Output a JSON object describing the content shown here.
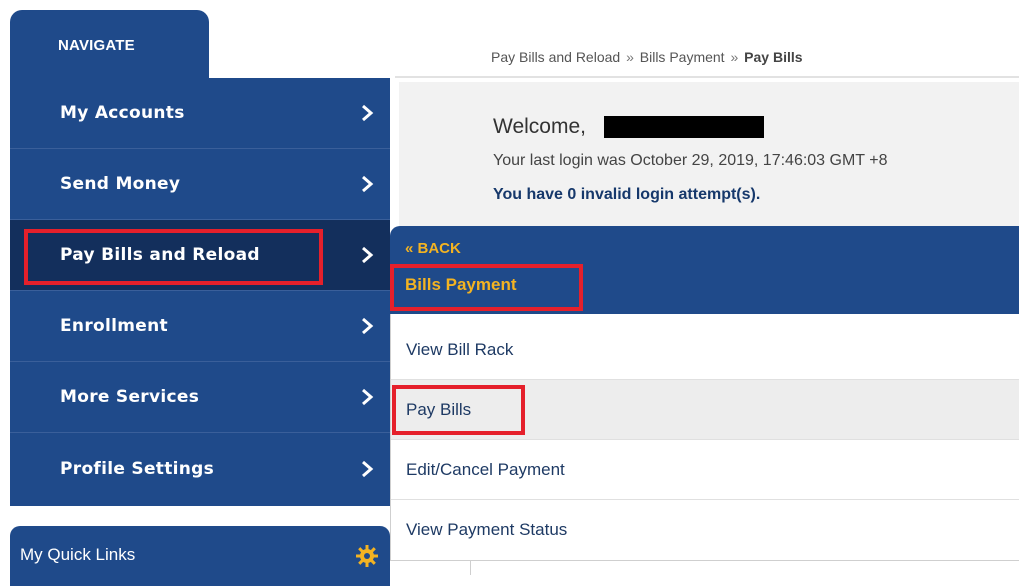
{
  "nav": {
    "tab_label": "NAVIGATE",
    "items": [
      {
        "label": "My Accounts"
      },
      {
        "label": "Send Money"
      },
      {
        "label": "Pay Bills and Reload"
      },
      {
        "label": "Enrollment"
      },
      {
        "label": "More Services"
      },
      {
        "label": "Profile Settings"
      }
    ],
    "active_item": "Pay Bills and Reload"
  },
  "quick_links": {
    "label": "My Quick Links",
    "icon": "gear-icon"
  },
  "breadcrumb": {
    "item1": "Pay Bills and Reload",
    "item2": "Bills Payment",
    "current": "Pay Bills",
    "separator": "»"
  },
  "welcome": {
    "greeting": "Welcome,",
    "last_login": "Your last login was October 29, 2019, 17:46:03 GMT +8",
    "invalid_login": "You have 0 invalid login attempt(s)."
  },
  "submenu": {
    "back_label": "« BACK",
    "title": "Bills Payment",
    "items": [
      {
        "label": "View Bill Rack"
      },
      {
        "label": "Pay Bills"
      },
      {
        "label": "Edit/Cancel Payment"
      },
      {
        "label": "View Payment Status"
      }
    ],
    "active_item": "Pay Bills"
  },
  "colors": {
    "nav_blue": "#1f4a8a",
    "nav_active": "#132f5c",
    "accent_gold": "#f3b322",
    "highlight_red": "#e5202b",
    "link_blue": "#1e3a64"
  }
}
